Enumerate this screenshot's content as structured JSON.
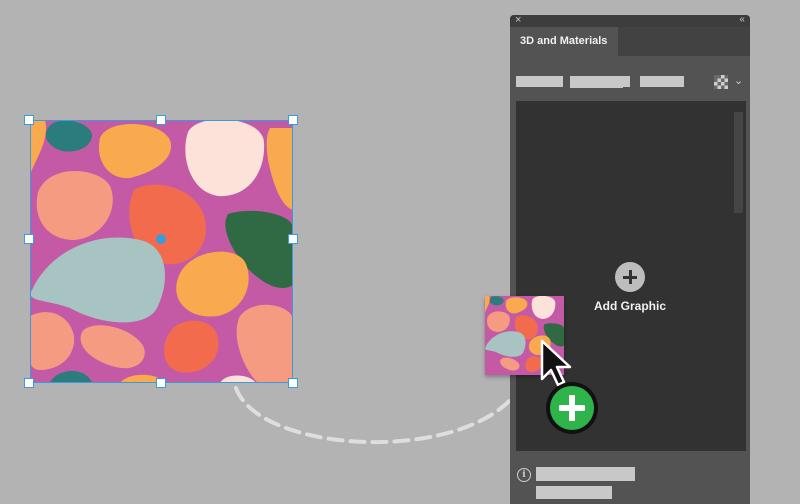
{
  "panel": {
    "title": "3D and Materials",
    "close_glyph": "×",
    "collapse_glyph": "‹‹",
    "chevron_glyph": "⌄",
    "info_glyph": "i",
    "add_graphic_label": "Add Graphic"
  },
  "icons": {
    "close": "close-icon",
    "collapse": "collapse-panel-icon",
    "grid": "checkerboard-grid-icon",
    "chevron": "chevron-down-icon",
    "add": "add-circle-icon",
    "info": "info-icon",
    "cursor": "arrow-cursor-icon",
    "copy_badge": "plus-badge-icon"
  },
  "colors": {
    "canvas": "#b3b3b4",
    "panel": "#535353",
    "well": "#323232",
    "selection": "#3b9ad9",
    "pattern_bg": "#c45aa6",
    "blob_orange": "#f9a94e",
    "blob_peach": "#f49b82",
    "blob_cream": "#fde2d9",
    "blob_red": "#f26b4d",
    "blob_teal": "#2b7c7d",
    "blob_green": "#2f6a45",
    "blob_sage": "#a7c3c2",
    "badge_green": "#2fb34b"
  }
}
